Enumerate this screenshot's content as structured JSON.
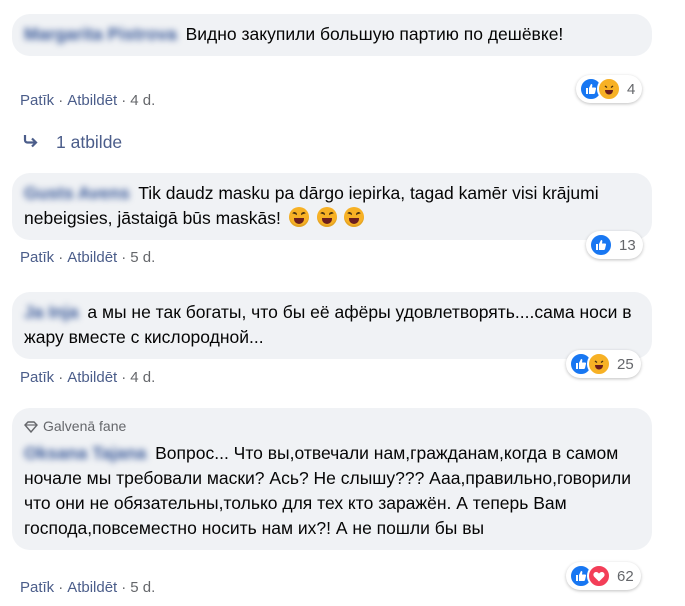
{
  "comments": [
    {
      "author": "Margarita Pistrova",
      "text": "Видно закупили большую партию по дешёвке!",
      "actions": {
        "like": "Patīk",
        "reply": "Atbildēt",
        "time": "4 d."
      },
      "reactions": {
        "icons": [
          "like",
          "haha"
        ],
        "count": "4"
      },
      "replies_label": "1 atbilde"
    },
    {
      "author": "Gusts Avens",
      "text": "Tik daudz masku pa dārgo iepirka, tagad kamēr visi krājumi nebeigsies, jāstaigā būs maskās!",
      "emoji_count": 3,
      "actions": {
        "like": "Patīk",
        "reply": "Atbildēt",
        "time": "5 d."
      },
      "reactions": {
        "icons": [
          "like"
        ],
        "count": "13"
      }
    },
    {
      "author": "Ja Inja",
      "text": "а мы не так богаты, что бы её афёры удовлетворять....сама носи в жару вместе с кислородной...",
      "actions": {
        "like": "Patīk",
        "reply": "Atbildēt",
        "time": "4 d."
      },
      "reactions": {
        "icons": [
          "like",
          "haha"
        ],
        "count": "25"
      }
    },
    {
      "badge": "Galvenā fane",
      "author": "Oksana Tajana",
      "text": "Вопрос... Что вы,отвечали нам,гражданам,когда в самом ночале мы требовали маски? Ась? Не слышу??? Ааа,правильно,говорили что они не обязательны,только для тех кто заражён. А теперь Вам господа,повсеместно носить нам их?! А не пошли бы вы",
      "actions": {
        "like": "Patīk",
        "reply": "Atbildēt",
        "time": "5 d."
      },
      "reactions": {
        "icons": [
          "like",
          "love"
        ],
        "count": "62"
      }
    }
  ],
  "colors": {
    "bubble": "#f0f2f5",
    "like": "#1877f2",
    "haha": "#f7b125",
    "love": "#f33e58",
    "link": "#4b5d8a",
    "meta": "#65676b"
  }
}
